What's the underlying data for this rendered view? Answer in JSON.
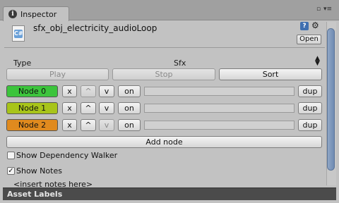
{
  "window": {
    "tab_label": "Inspector",
    "tab_icon": "i",
    "controls": {
      "lock": "🔒",
      "menu": "▾≡"
    }
  },
  "asset": {
    "name": "sfx_obj_electricity_audioLoop",
    "icon_text": "C#",
    "open_label": "Open"
  },
  "type_row": {
    "label": "Type",
    "value": "Sfx",
    "arrows": "▲▼"
  },
  "actions": {
    "play": "Play",
    "stop": "Stop",
    "sort": "Sort"
  },
  "nodes": [
    {
      "label": "Node 0",
      "color": "#3cc43c",
      "remove": "x",
      "up": "^",
      "down": "v",
      "on": "on",
      "dup": "dup",
      "up_enabled": false,
      "down_enabled": true
    },
    {
      "label": "Node 1",
      "color": "#a8c41a",
      "remove": "x",
      "up": "^",
      "down": "v",
      "on": "on",
      "dup": "dup",
      "up_enabled": true,
      "down_enabled": true
    },
    {
      "label": "Node 2",
      "color": "#e08a1e",
      "remove": "x",
      "up": "^",
      "down": "v",
      "on": "on",
      "dup": "dup",
      "up_enabled": true,
      "down_enabled": false
    }
  ],
  "add_node_label": "Add node",
  "options": {
    "dependency_walker": {
      "label": "Show Dependency Walker",
      "checked": false
    },
    "show_notes": {
      "label": "Show Notes",
      "checked": true
    }
  },
  "notes_text": "<insert notes here>",
  "footer": {
    "label": "Asset Labels"
  }
}
